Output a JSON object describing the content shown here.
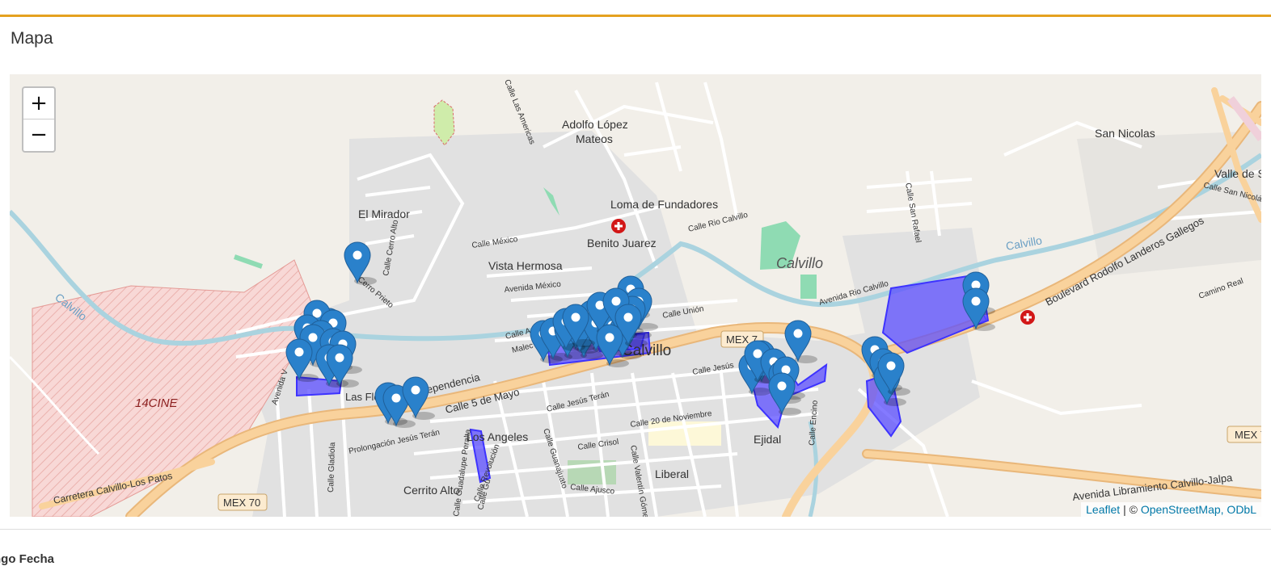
{
  "theme": {
    "accent": "#e5a11f",
    "link": "#0078a8",
    "marker": "#2a81cb",
    "polygon": "#5b4dff"
  },
  "panel": {
    "title": "Mapa"
  },
  "map": {
    "zoom_in_label": "+",
    "zoom_out_label": "−",
    "attribution": {
      "leaflet": "Leaflet",
      "separator": " | © ",
      "osm": "OpenStreetMap, ODbL"
    },
    "places": [
      "Adolfo López",
      "Mateos",
      "Loma de Fundadores",
      "El Mirador",
      "Benito Juarez",
      "Vista Hermosa",
      "Calvillo",
      "Calvillo",
      "Calvillo",
      "Calvillo",
      "San Nicolas",
      "Valle de S",
      "14CINE",
      "Las Flo",
      "Los Angeles",
      "Cerrito Alto",
      "Liberal",
      "Ejidal",
      "MEX 70",
      "MEX 70",
      "MEX 7",
      "Calle 5 de Mayo",
      "dependencia",
      "Boulevard Rodolfo Landeros Gallegos",
      "Avenida Libramiento Calvillo-Jalpa",
      "Carretera Calvillo-Los Patos",
      "Calle Las Americas",
      "Calle Cerro Alto",
      "Cerro Prieto",
      "Calle México",
      "Avenida México",
      "Calle Rio Calvillo",
      "Avenida Rio Calvillo",
      "Calle Unión",
      "Calle Jesús Terán",
      "Prolongación Jesús Terán",
      "Calle 20 de Noviembre",
      "Calle Crisol",
      "Calle Ajusco",
      "Calle Guanajuato",
      "Calle Revolución",
      "Calle Guadalupe Peralta",
      "Calle Gladiola",
      "Calle Encino",
      "Calle San Rafael",
      "Camino Real",
      "Calle San Nicolás",
      "Calle Valentín Gómez",
      "Malec",
      "Calle A",
      "Avenida V",
      "Calle Jesús",
      "Calle Gu"
    ],
    "marker_count": 52,
    "polygon_count": 8
  },
  "below": {
    "label": "ngo Fecha"
  }
}
